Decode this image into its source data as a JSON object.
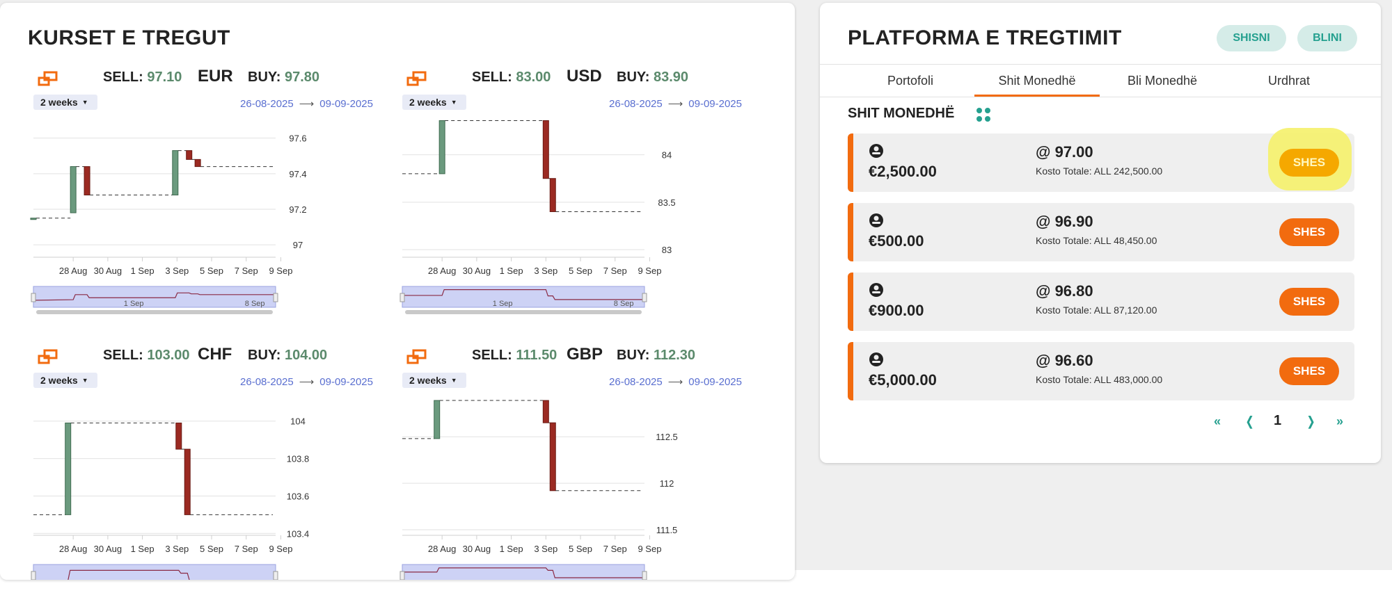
{
  "market": {
    "title": "KURSET E TREGUT",
    "panels": [
      {
        "currency": "EUR",
        "sell_label": "SELL:",
        "sell": "97.10",
        "buy_label": "BUY:",
        "buy": "97.80",
        "range": "2 weeks",
        "date_from": "26-08-2025",
        "date_to": "09-09-2025",
        "chart_data": {
          "type": "candlestick",
          "x_ticks": [
            "28 Aug",
            "30 Aug",
            "1 Sep",
            "3 Sep",
            "5 Sep",
            "7 Sep",
            "9 Sep"
          ],
          "y_ticks": [
            "97.6",
            "97.4",
            "97.2",
            "97"
          ],
          "ylim": [
            96.93,
            97.72
          ],
          "navigator_ticks": [
            "1 Sep",
            "8 Sep"
          ],
          "candles": [
            {
              "day": 0.0,
              "open": 97.15,
              "close": 97.15
            },
            {
              "day": 2.3,
              "open": 97.18,
              "close": 97.44
            },
            {
              "day": 3.1,
              "open": 97.44,
              "close": 97.28
            },
            {
              "day": 8.2,
              "open": 97.28,
              "close": 97.53
            },
            {
              "day": 9.0,
              "open": 97.53,
              "close": 97.48
            },
            {
              "day": 9.5,
              "open": 97.48,
              "close": 97.44
            }
          ],
          "last": 97.44
        }
      },
      {
        "currency": "USD",
        "sell_label": "SELL:",
        "sell": "83.00",
        "buy_label": "BUY:",
        "buy": "83.90",
        "range": "2 weeks",
        "date_from": "26-08-2025",
        "date_to": "09-09-2025",
        "chart_data": {
          "type": "candlestick",
          "x_ticks": [
            "28 Aug",
            "30 Aug",
            "1 Sep",
            "3 Sep",
            "5 Sep",
            "7 Sep",
            "9 Sep"
          ],
          "y_ticks": [
            "84",
            "83.5",
            "83"
          ],
          "ylim": [
            82.92,
            84.4
          ],
          "navigator_ticks": [
            "1 Sep",
            "8 Sep"
          ],
          "candles": [
            {
              "day": 2.3,
              "open": 83.8,
              "close": 84.36
            },
            {
              "day": 8.3,
              "open": 84.36,
              "close": 83.75
            },
            {
              "day": 8.7,
              "open": 83.75,
              "close": 83.4
            }
          ],
          "last": 83.4
        }
      },
      {
        "currency": "CHF",
        "sell_label": "SELL:",
        "sell": "103.00",
        "buy_label": "BUY:",
        "buy": "104.00",
        "range": "2 weeks",
        "date_from": "26-08-2025",
        "date_to": "09-09-2025",
        "chart_data": {
          "type": "candlestick",
          "x_ticks": [
            "28 Aug",
            "30 Aug",
            "1 Sep",
            "3 Sep",
            "5 Sep",
            "7 Sep",
            "9 Sep"
          ],
          "y_ticks": [
            "104",
            "103.8",
            "103.6",
            "103.4"
          ],
          "ylim": [
            103.39,
            104.14
          ],
          "navigator_ticks": [],
          "candles": [
            {
              "day": 2.0,
              "open": 103.5,
              "close": 103.99
            },
            {
              "day": 8.4,
              "open": 103.99,
              "close": 103.85
            },
            {
              "day": 8.9,
              "open": 103.85,
              "close": 103.5
            }
          ],
          "last": 103.5
        }
      },
      {
        "currency": "GBP",
        "sell_label": "SELL:",
        "sell": "111.50",
        "buy_label": "BUY:",
        "buy": "112.30",
        "range": "2 weeks",
        "date_from": "26-08-2025",
        "date_to": "09-09-2025",
        "chart_data": {
          "type": "candlestick",
          "x_ticks": [
            "28 Aug",
            "30 Aug",
            "1 Sep",
            "3 Sep",
            "5 Sep",
            "7 Sep",
            "9 Sep"
          ],
          "y_ticks": [
            "112.5",
            "112",
            "111.5"
          ],
          "ylim": [
            111.44,
            112.95
          ],
          "navigator_ticks": [],
          "candles": [
            {
              "day": 2.0,
              "open": 112.48,
              "close": 112.89
            },
            {
              "day": 8.3,
              "open": 112.89,
              "close": 112.65
            },
            {
              "day": 8.7,
              "open": 112.65,
              "close": 111.92
            }
          ],
          "last": 111.92
        }
      }
    ]
  },
  "trading": {
    "title": "PLATFORMA E TREGTIMIT",
    "sell_pill": "SHISNI",
    "buy_pill": "BLINI",
    "tabs": [
      "Portofoli",
      "Shit Monedhë",
      "Bli Monedhë",
      "Urdhrat"
    ],
    "active_tab": 1,
    "section_title": "SHIT MONEDHË",
    "orders": [
      {
        "amount": "€2,500.00",
        "price": "@ 97.00",
        "cost": "Kosto Totale: ALL 242,500.00",
        "action": "SHES"
      },
      {
        "amount": "€500.00",
        "price": "@ 96.90",
        "cost": "Kosto Totale: ALL 48,450.00",
        "action": "SHES"
      },
      {
        "amount": "€900.00",
        "price": "@ 96.80",
        "cost": "Kosto Totale: ALL 87,120.00",
        "action": "SHES"
      },
      {
        "amount": "€5,000.00",
        "price": "@ 96.60",
        "cost": "Kosto Totale: ALL 483,000.00",
        "action": "SHES"
      }
    ],
    "pager": {
      "first": "«",
      "prev": "❬",
      "page": "1",
      "next": "❭",
      "last": "»"
    }
  },
  "colors": {
    "accent": "#f26b0f",
    "teal": "#25a08f",
    "up": "#6b9a7e",
    "down": "#9b2a22",
    "value_green": "#5b8a6c",
    "date_blue": "#5a6fd0"
  }
}
